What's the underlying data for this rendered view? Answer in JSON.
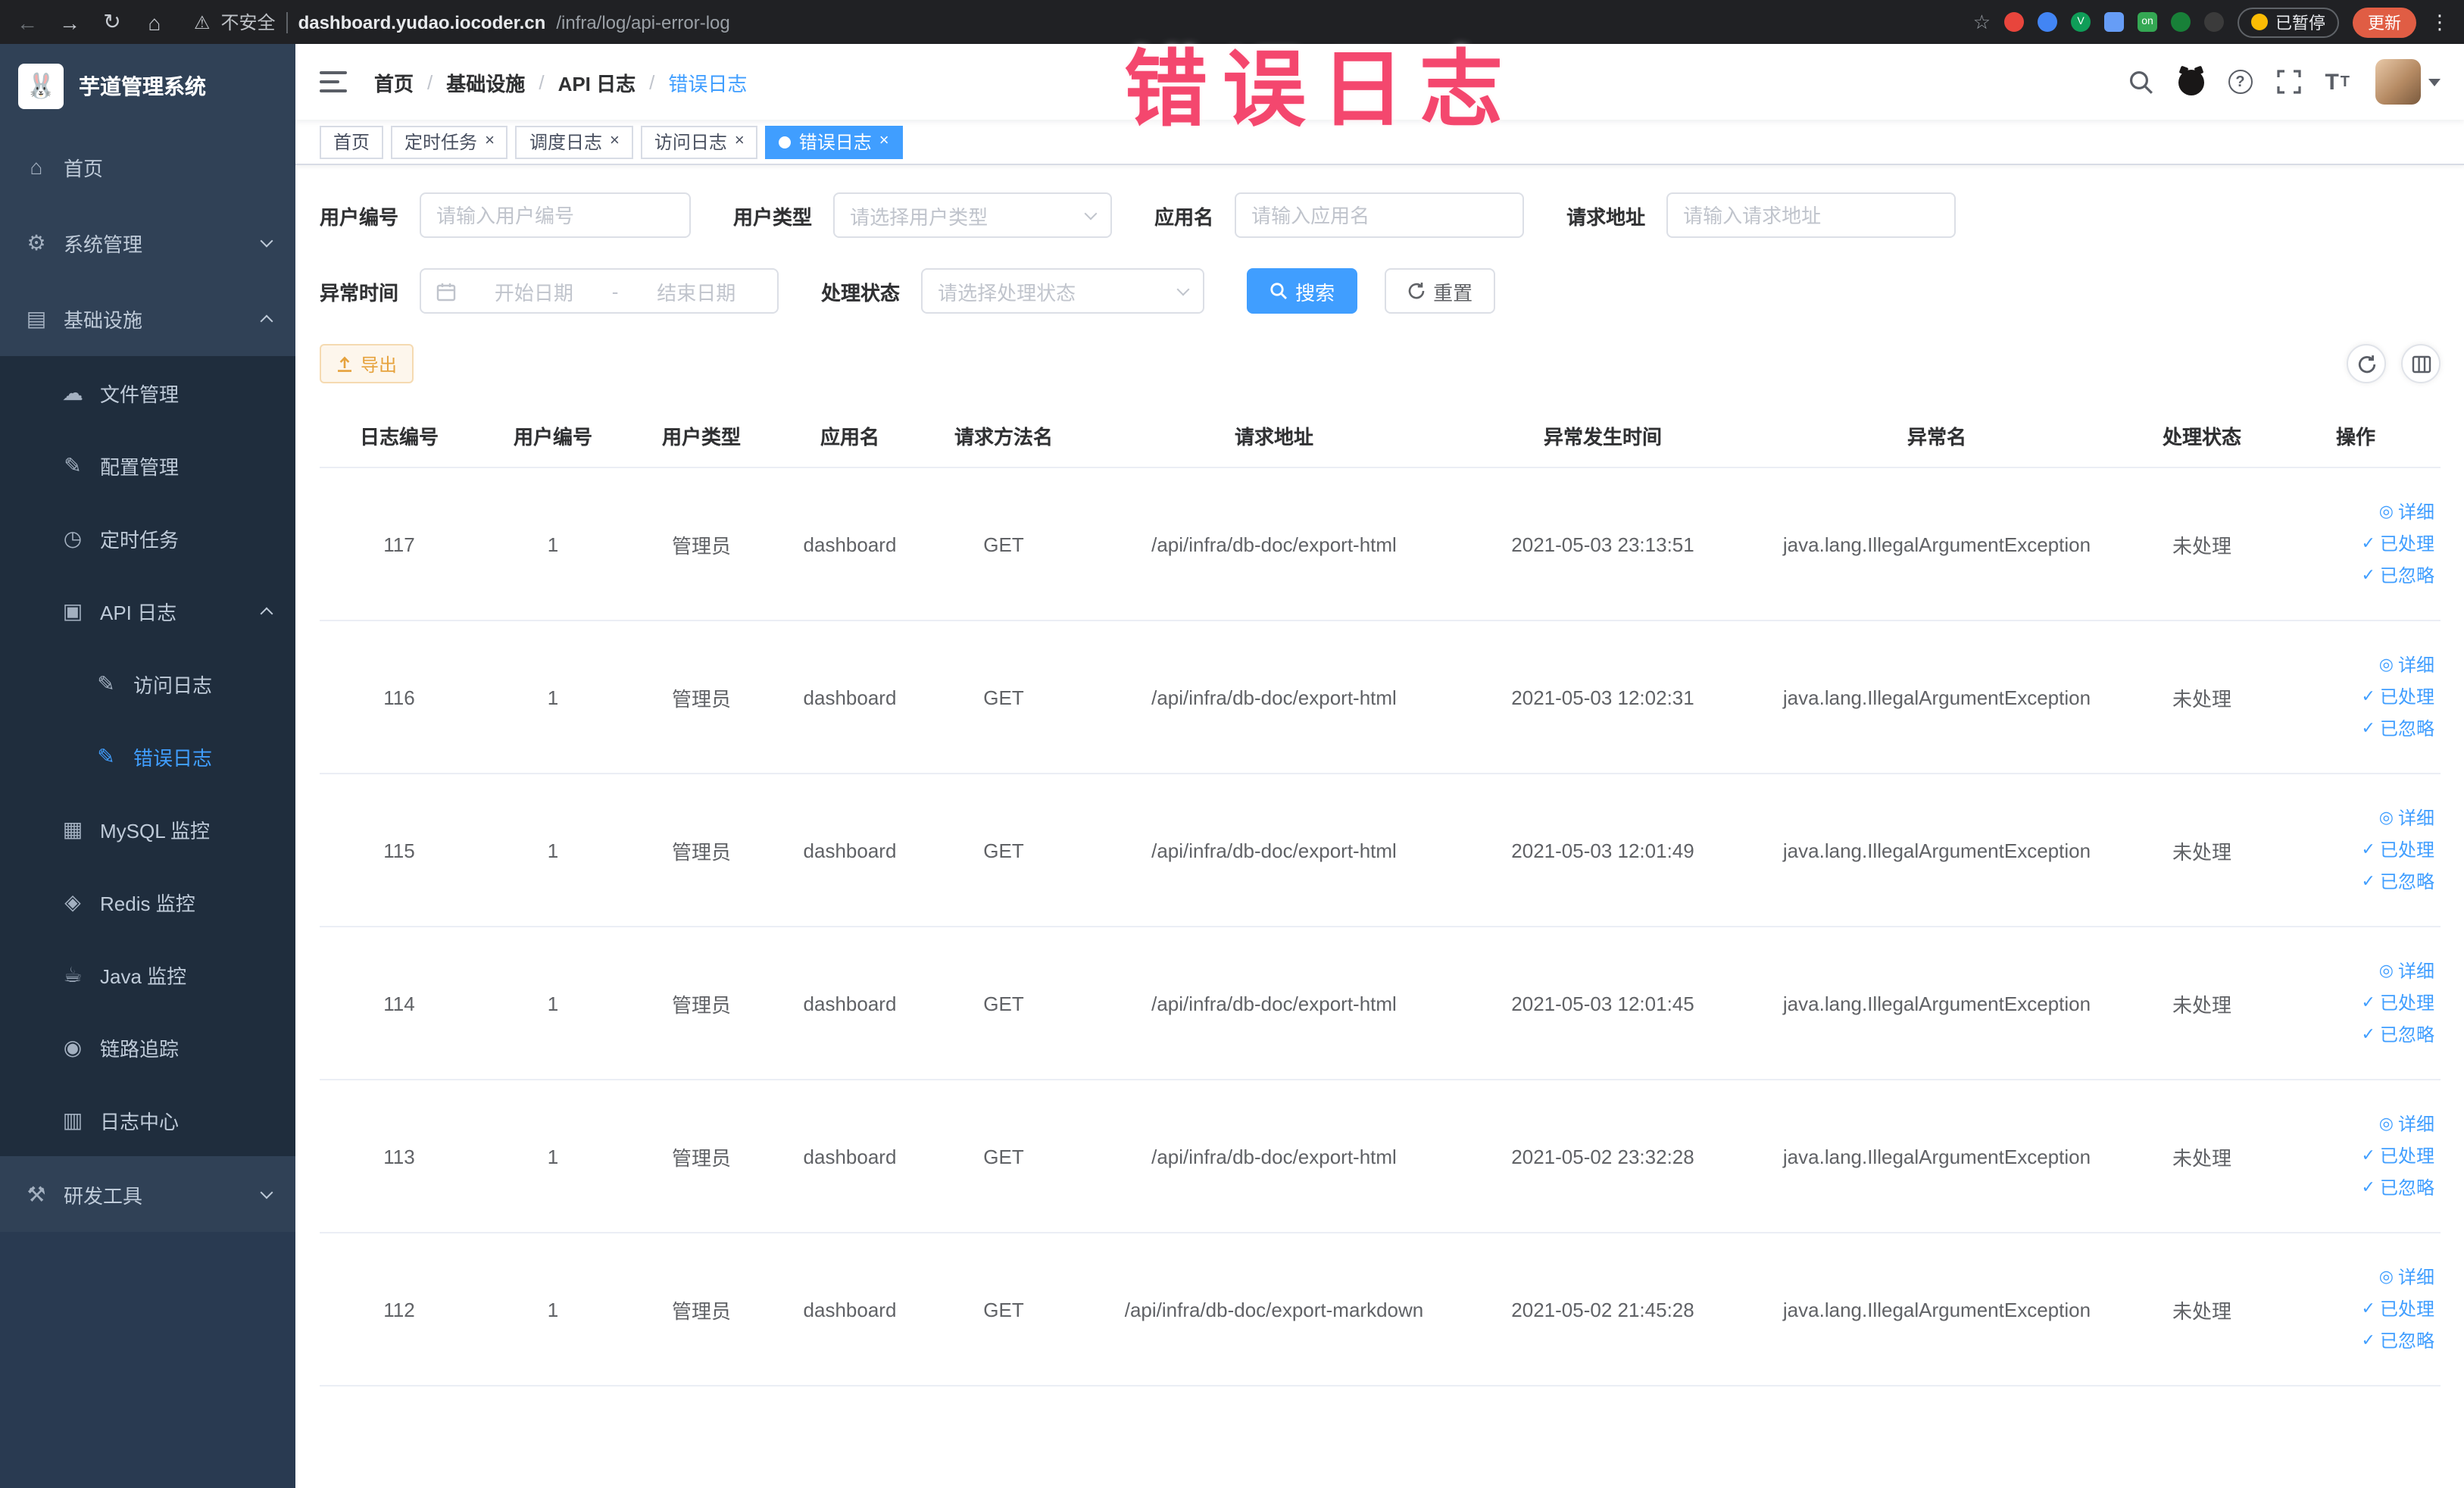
{
  "browser": {
    "security_label": "不安全",
    "url_host": "dashboard.yudao.iocoder.cn",
    "url_path": "/infra/log/api-error-log",
    "extension_badge": "on",
    "paused_label": "已暂停",
    "update_label": "更新"
  },
  "overlay_text": "错误日志",
  "sidebar": {
    "logo_title": "芋道管理系统",
    "items": [
      {
        "label": "首页"
      },
      {
        "label": "系统管理"
      },
      {
        "label": "基础设施"
      },
      {
        "label": "文件管理"
      },
      {
        "label": "配置管理"
      },
      {
        "label": "定时任务"
      },
      {
        "label": "API 日志"
      },
      {
        "label": "访问日志"
      },
      {
        "label": "错误日志"
      },
      {
        "label": "MySQL 监控"
      },
      {
        "label": "Redis 监控"
      },
      {
        "label": "Java 监控"
      },
      {
        "label": "链路追踪"
      },
      {
        "label": "日志中心"
      },
      {
        "label": "研发工具"
      }
    ]
  },
  "header": {
    "breadcrumb": [
      {
        "label": "首页"
      },
      {
        "label": "基础设施"
      },
      {
        "label": "API 日志"
      },
      {
        "label": "错误日志"
      }
    ]
  },
  "tabs": [
    {
      "label": "首页"
    },
    {
      "label": "定时任务"
    },
    {
      "label": "调度日志"
    },
    {
      "label": "访问日志"
    },
    {
      "label": "错误日志"
    }
  ],
  "filters": {
    "user_id_label": "用户编号",
    "user_id_placeholder": "请输入用户编号",
    "user_type_label": "用户类型",
    "user_type_placeholder": "请选择用户类型",
    "app_name_label": "应用名",
    "app_name_placeholder": "请输入应用名",
    "request_url_label": "请求地址",
    "request_url_placeholder": "请输入请求地址",
    "time_label": "异常时间",
    "time_start_placeholder": "开始日期",
    "time_separator": "-",
    "time_end_placeholder": "结束日期",
    "status_label": "处理状态",
    "status_placeholder": "请选择处理状态",
    "search_label": "搜索",
    "reset_label": "重置"
  },
  "toolbar": {
    "export_label": "导出"
  },
  "table": {
    "columns": [
      "日志编号",
      "用户编号",
      "用户类型",
      "应用名",
      "请求方法名",
      "请求地址",
      "异常发生时间",
      "异常名",
      "处理状态",
      "操作"
    ],
    "action_detail": "详细",
    "action_processed": "已处理",
    "action_ignored": "已忽略",
    "rows": [
      {
        "id": "117",
        "user_id": "1",
        "user_type": "管理员",
        "app_name": "dashboard",
        "method": "GET",
        "url": "/api/infra/db-doc/export-html",
        "time": "2021-05-03 23:13:51",
        "exception": "java.lang.IllegalArgumentException",
        "status": "未处理"
      },
      {
        "id": "116",
        "user_id": "1",
        "user_type": "管理员",
        "app_name": "dashboard",
        "method": "GET",
        "url": "/api/infra/db-doc/export-html",
        "time": "2021-05-03 12:02:31",
        "exception": "java.lang.IllegalArgumentException",
        "status": "未处理"
      },
      {
        "id": "115",
        "user_id": "1",
        "user_type": "管理员",
        "app_name": "dashboard",
        "method": "GET",
        "url": "/api/infra/db-doc/export-html",
        "time": "2021-05-03 12:01:49",
        "exception": "java.lang.IllegalArgumentException",
        "status": "未处理"
      },
      {
        "id": "114",
        "user_id": "1",
        "user_type": "管理员",
        "app_name": "dashboard",
        "method": "GET",
        "url": "/api/infra/db-doc/export-html",
        "time": "2021-05-03 12:01:45",
        "exception": "java.lang.IllegalArgumentException",
        "status": "未处理"
      },
      {
        "id": "113",
        "user_id": "1",
        "user_type": "管理员",
        "app_name": "dashboard",
        "method": "GET",
        "url": "/api/infra/db-doc/export-html",
        "time": "2021-05-02 23:32:28",
        "exception": "java.lang.IllegalArgumentException",
        "status": "未处理"
      },
      {
        "id": "112",
        "user_id": "1",
        "user_type": "管理员",
        "app_name": "dashboard",
        "method": "GET",
        "url": "/api/infra/db-doc/export-markdown",
        "time": "2021-05-02 21:45:28",
        "exception": "java.lang.IllegalArgumentException",
        "status": "未处理"
      }
    ]
  }
}
